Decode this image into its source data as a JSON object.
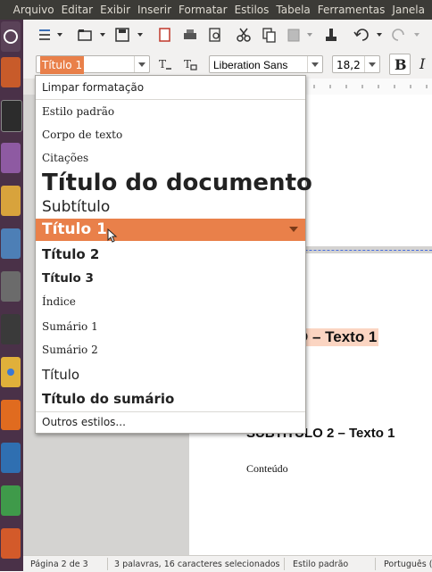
{
  "menubar": {
    "items": [
      "Arquivo",
      "Editar",
      "Exibir",
      "Inserir",
      "Formatar",
      "Estilos",
      "Tabela",
      "Ferramentas",
      "Janela"
    ]
  },
  "toolbar": {
    "paragraph_style": "Título 1",
    "font_name": "Liberation Sans",
    "font_size": "18,2"
  },
  "style_menu": {
    "clear": "Limpar formatação",
    "items": [
      "Estilo padrão",
      "Corpo de texto",
      "Citações",
      "Título do documento",
      "Subtítulo",
      "Título 1",
      "Título 2",
      "Título 3",
      "Índice",
      "Sumário 1",
      "Sumário 2",
      "Título",
      "Título do sumário"
    ],
    "more": "Outros estilos...",
    "highlighted_index": 5
  },
  "document": {
    "heading1_partial": "O – Texto 1",
    "subtitle_partial": "SUBTÍTULO 2 – Texto 1",
    "body": "Conteúdo"
  },
  "statusbar": {
    "page": "Página 2 de 3",
    "words": "3 palavras, 16 caracteres selecionados",
    "style": "Estilo padrão",
    "language": "Português ("
  },
  "colors": {
    "highlight": "#e9804a",
    "menubar": "#3c3b37",
    "launcher": "#4a3148",
    "selection": "#fbd5c2"
  }
}
